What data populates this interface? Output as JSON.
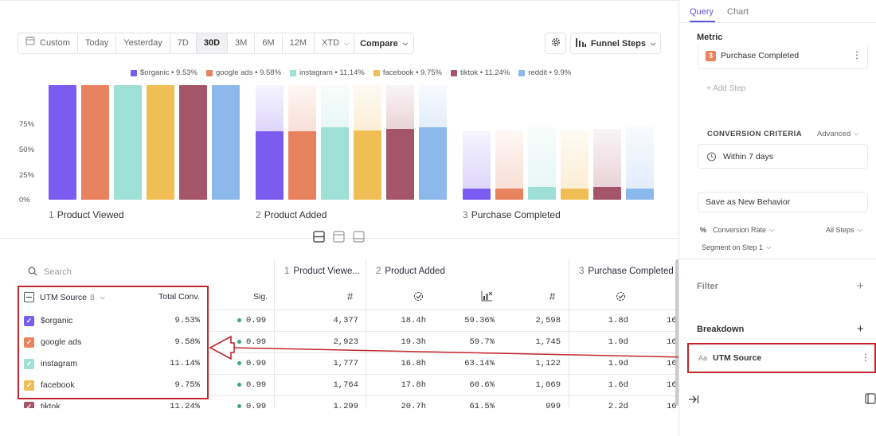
{
  "toolbar": {
    "custom": "Custom",
    "ranges": [
      "Today",
      "Yesterday",
      "7D",
      "30D",
      "3M",
      "6M",
      "12M",
      "XTD"
    ],
    "active_range": "30D",
    "compare": "Compare",
    "funnel_steps": "Funnel Steps"
  },
  "legend": [
    {
      "label": "$organic • 9.53%",
      "color": "#7b5cf0"
    },
    {
      "label": "google ads • 9.58%",
      "color": "#e8825f"
    },
    {
      "label": "instagram • 11.14%",
      "color": "#9fe0d6"
    },
    {
      "label": "facebook • 9.75%",
      "color": "#efbe55"
    },
    {
      "label": "tiktok • 11.24%",
      "color": "#a55569"
    },
    {
      "label": "reddit • 9.9%",
      "color": "#8db8ec"
    }
  ],
  "chart_data": {
    "type": "bar",
    "categories": [
      "Product Viewed",
      "Product Added",
      "Purchase Completed"
    ],
    "ylim": [
      0,
      100
    ],
    "yticks": [
      "75%",
      "50%",
      "25%",
      "0%"
    ],
    "step_numbers": [
      "1",
      "2",
      "3"
    ],
    "series": [
      {
        "name": "$organic",
        "color": "#7b5cf0",
        "values": [
          100,
          59.4,
          9.53
        ]
      },
      {
        "name": "google ads",
        "color": "#e8825f",
        "values": [
          100,
          59.7,
          9.58
        ]
      },
      {
        "name": "instagram",
        "color": "#9fe0d6",
        "values": [
          100,
          63.1,
          11.14
        ]
      },
      {
        "name": "facebook",
        "color": "#efbe55",
        "values": [
          100,
          60.6,
          9.75
        ]
      },
      {
        "name": "tiktok",
        "color": "#a55569",
        "values": [
          100,
          61.5,
          11.24
        ]
      },
      {
        "name": "reddit",
        "color": "#8db8ec",
        "values": [
          100,
          63.5,
          9.9
        ]
      }
    ]
  },
  "table": {
    "search_placeholder": "Search",
    "group_label": "UTM Source",
    "group_count": "8",
    "total_conv": "Total Conv.",
    "sig": "Sig.",
    "step1": {
      "num": "1",
      "label": "Product Viewe..."
    },
    "step2": {
      "num": "2",
      "label": "Product Added"
    },
    "step3": {
      "num": "3",
      "label": "Purchase Completed"
    },
    "hash": "#",
    "rows": [
      {
        "name": "$organic",
        "color": "#7b5cf0",
        "total": "9.53%",
        "sig": "0.99",
        "v1": "4,377",
        "t2": "18.4h",
        "c2": "59.36%",
        "v2": "2,598",
        "t3": "1.8d",
        "c3": "16"
      },
      {
        "name": "google ads",
        "color": "#e8825f",
        "total": "9.58%",
        "sig": "0.99",
        "v1": "2,923",
        "t2": "19.3h",
        "c2": "59.7%",
        "v2": "1,745",
        "t3": "1.9d",
        "c3": "16"
      },
      {
        "name": "instagram",
        "color": "#9fe0d6",
        "total": "11.14%",
        "sig": "0.99",
        "v1": "1,777",
        "t2": "16.8h",
        "c2": "63.14%",
        "v2": "1,122",
        "t3": "1.9d",
        "c3": "16"
      },
      {
        "name": "facebook",
        "color": "#efbe55",
        "total": "9.75%",
        "sig": "0.99",
        "v1": "1,764",
        "t2": "17.8h",
        "c2": "60.6%",
        "v2": "1,069",
        "t3": "1.6d",
        "c3": "16"
      }
    ],
    "partial_row": {
      "name": "tiktok",
      "total": "11.24%",
      "sig": "0.99",
      "v1": "1,299",
      "t2": "20.7h",
      "c2": "61.5%",
      "v2": "999",
      "t3": "2.2d",
      "c3": "16"
    }
  },
  "right_panel": {
    "tabs": [
      "Query",
      "Chart"
    ],
    "metric_title": "Metric",
    "step_num": "3",
    "step_label": "Purchase Completed",
    "add_step": "+ Add Step",
    "conversion_criteria": "CONVERSION CRITERIA",
    "advanced": "Advanced",
    "within": "Within 7 days",
    "save_behavior": "Save as New Behavior",
    "percent_symbol": "%",
    "conversion_rate": "Conversion Rate",
    "all_steps": "All Steps",
    "segment": "Segment on Step 1",
    "filter": "Filter",
    "breakdown": "Breakdown",
    "aa": "Aa",
    "utm_source": "UTM Source"
  }
}
